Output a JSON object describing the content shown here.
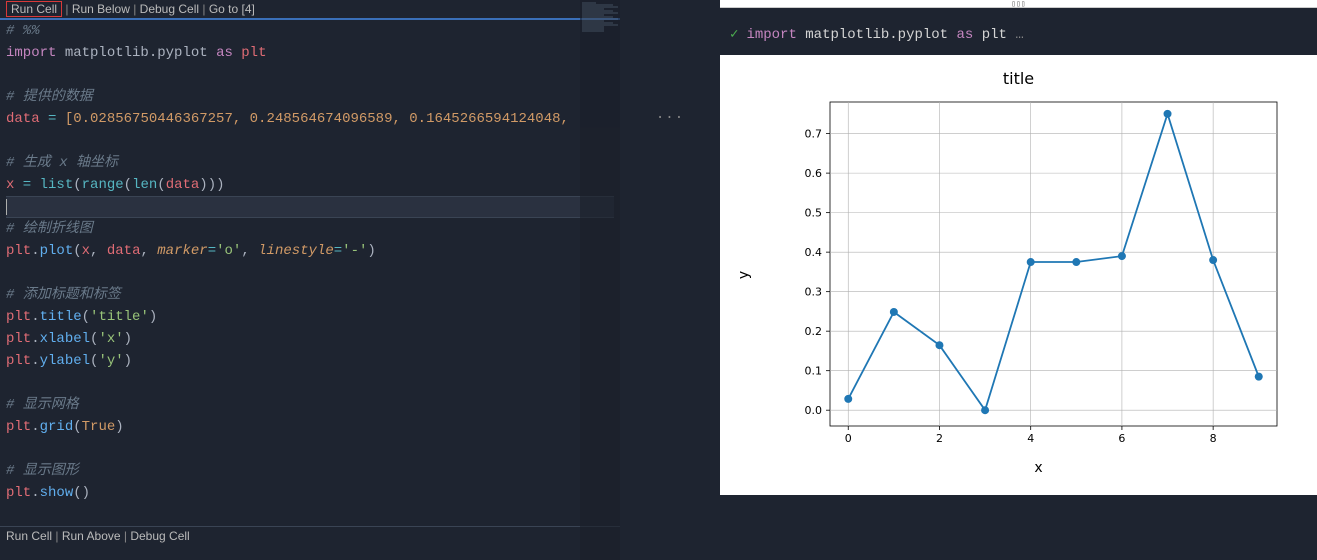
{
  "cell_lens_top": {
    "run_cell": "Run Cell",
    "run_below": "Run Below",
    "debug_cell": "Debug Cell",
    "goto": "Go to [4]"
  },
  "cell_lens_bottom": {
    "run_cell": "Run Cell",
    "run_above": "Run Above",
    "debug_cell": "Debug Cell"
  },
  "code_lines": {
    "l1": "# %%",
    "l2_import": "import",
    "l2_mod": " matplotlib.pyplot ",
    "l2_as": "as",
    "l2_alias": " plt",
    "l3": "# 提供的数据",
    "l4_var": "data",
    "l4_eq": " = ",
    "l4_vals": "[0.02856750446367257, 0.248564674096589, 0.1645266594124048,",
    "l5": "# 生成 x 轴坐标",
    "l6_var": "x",
    "l6_eq": " = ",
    "l6_list": "list",
    "l6_open": "(",
    "l6_range": "range",
    "l6_open2": "(",
    "l6_len": "len",
    "l6_open3": "(",
    "l6_data": "data",
    "l6_close": ")))",
    "l7": "# 绘制折线图",
    "l8_a": "plt",
    "l8_dot": ".",
    "l8_fn": "plot",
    "l8_open": "(",
    "l8_x": "x",
    "l8_c1": ", ",
    "l8_data": "data",
    "l8_c2": ", ",
    "l8_p1": "marker",
    "l8_eq1": "=",
    "l8_s1": "'o'",
    "l8_c3": ", ",
    "l8_p2": "linestyle",
    "l8_eq2": "=",
    "l8_s2": "'-'",
    "l8_close": ")",
    "l9": "# 添加标题和标签",
    "l10_a": "plt",
    "l10_dot": ".",
    "l10_fn": "title",
    "l10_args": "(",
    "l10_s": "'title'",
    "l10_close": ")",
    "l11_a": "plt",
    "l11_dot": ".",
    "l11_fn": "xlabel",
    "l11_args": "(",
    "l11_s": "'x'",
    "l11_close": ")",
    "l12_a": "plt",
    "l12_dot": ".",
    "l12_fn": "ylabel",
    "l12_args": "(",
    "l12_s": "'y'",
    "l12_close": ")",
    "l13": "# 显示网格",
    "l14_a": "plt",
    "l14_dot": ".",
    "l14_fn": "grid",
    "l14_open": "(",
    "l14_true": "True",
    "l14_close": ")",
    "l15": "# 显示图形",
    "l16_a": "plt",
    "l16_dot": ".",
    "l16_fn": "show",
    "l16_args": "()"
  },
  "gutter": {
    "dots": "···"
  },
  "output": {
    "header_import": "import",
    "header_mod": " matplotlib.pyplot ",
    "header_as": "as",
    "header_alias": " plt",
    "header_ellipsis": " …"
  },
  "chart_data": {
    "type": "line",
    "title": "title",
    "xlabel": "x",
    "ylabel": "y",
    "x": [
      0,
      1,
      2,
      3,
      4,
      5,
      6,
      7,
      8,
      9
    ],
    "y": [
      0.0286,
      0.2486,
      0.1645,
      0.0,
      0.375,
      0.375,
      0.39,
      0.75,
      0.38,
      0.085
    ],
    "x_ticks": [
      0,
      2,
      4,
      6,
      8
    ],
    "y_ticks": [
      0.0,
      0.1,
      0.2,
      0.3,
      0.4,
      0.5,
      0.6,
      0.7
    ],
    "xlim": [
      -0.4,
      9.4
    ],
    "ylim": [
      -0.04,
      0.78
    ],
    "grid": true,
    "marker": "o",
    "linestyle": "-",
    "line_color": "#1f77b4"
  }
}
